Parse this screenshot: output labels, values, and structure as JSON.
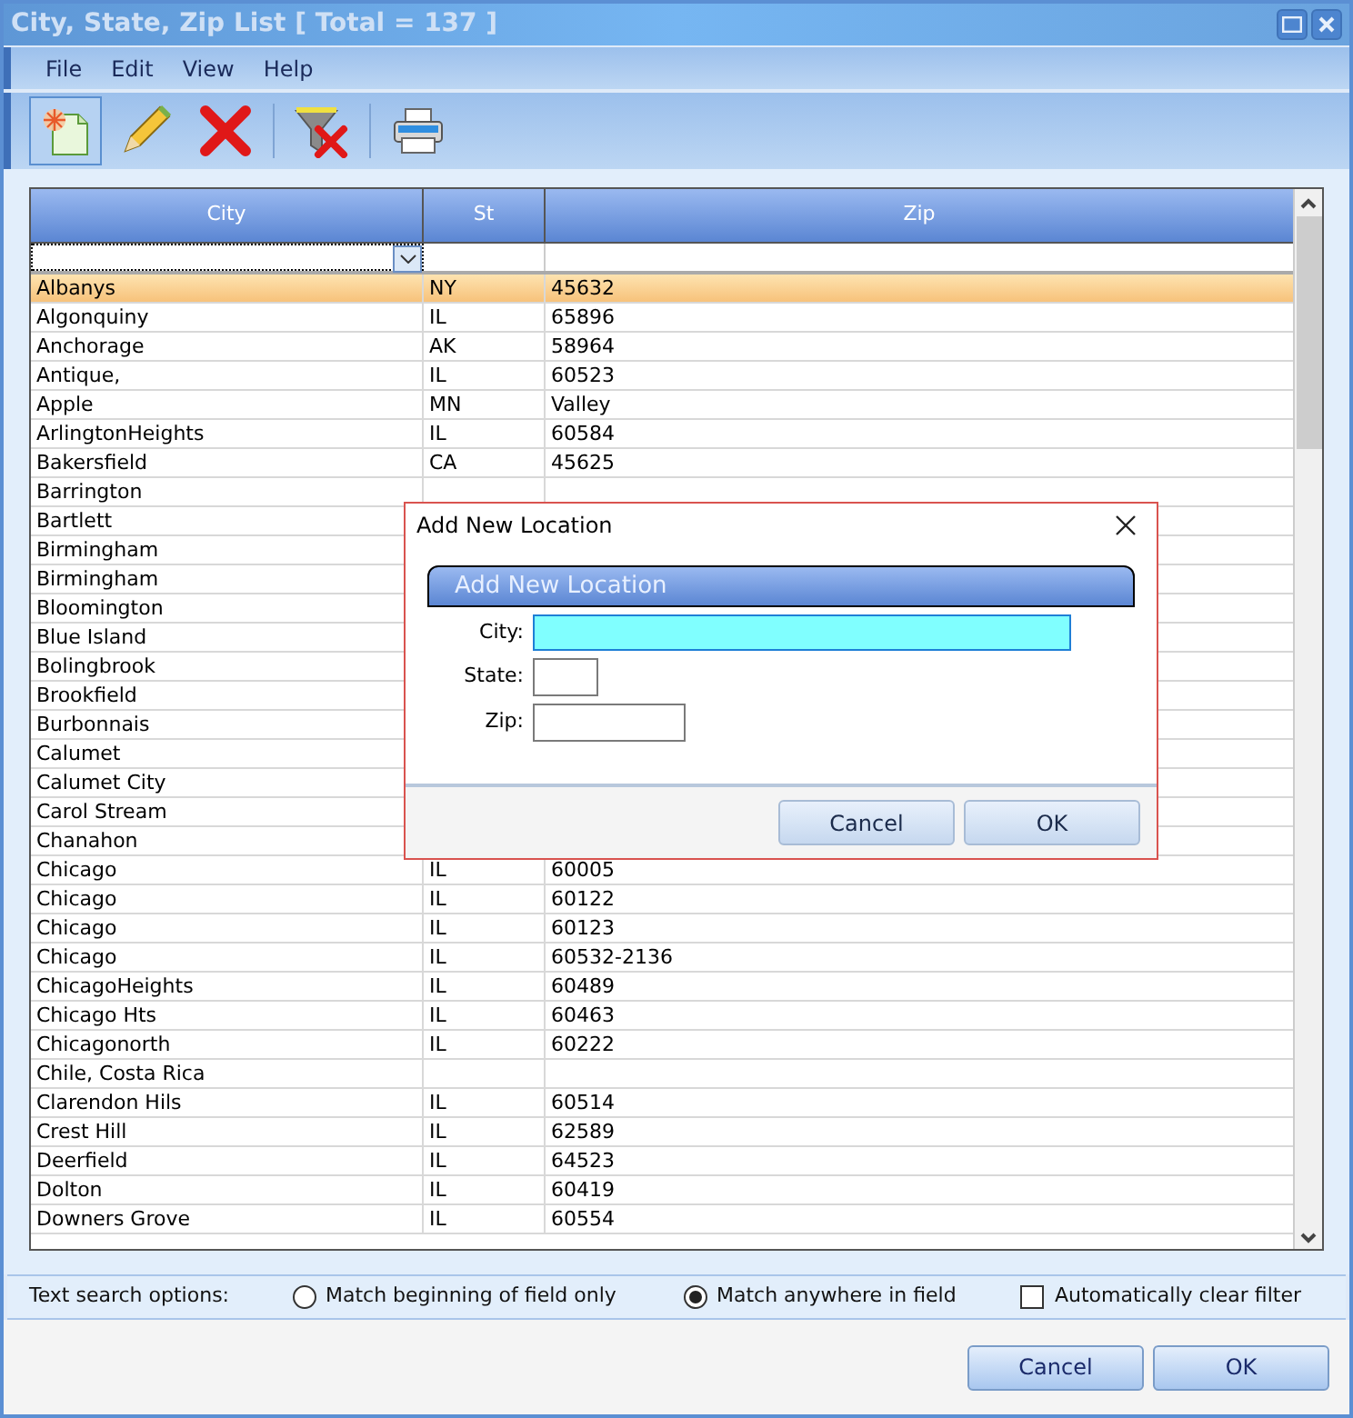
{
  "window": {
    "title": "City, State, Zip List [ Total = 137 ]"
  },
  "menu": [
    "File",
    "Edit",
    "View",
    "Help"
  ],
  "toolbar": [
    {
      "kind": "new",
      "selected": true
    },
    {
      "kind": "edit",
      "selected": false
    },
    {
      "kind": "delete",
      "selected": false
    },
    {
      "kind": "sep"
    },
    {
      "kind": "clearfilter",
      "selected": false
    },
    {
      "kind": "sep"
    },
    {
      "kind": "print",
      "selected": false
    }
  ],
  "table": {
    "columns": [
      "City",
      "St",
      "Zip"
    ],
    "rows": [
      {
        "city": "Albanys",
        "st": "NY",
        "zip": "45632",
        "selected": true
      },
      {
        "city": "Algonquiny",
        "st": "IL",
        "zip": "65896",
        "selected": false
      },
      {
        "city": "Anchorage",
        "st": "AK",
        "zip": "58964",
        "selected": false
      },
      {
        "city": "Antique,",
        "st": "IL",
        "zip": "60523",
        "selected": false
      },
      {
        "city": "Apple",
        "st": "MN",
        "zip": "Valley",
        "selected": false
      },
      {
        "city": "ArlingtonHeights",
        "st": "IL",
        "zip": "60584",
        "selected": false
      },
      {
        "city": "Bakersfield",
        "st": "CA",
        "zip": "45625",
        "selected": false
      },
      {
        "city": "Barrington",
        "selected": false
      },
      {
        "city": "Bartlett",
        "selected": false
      },
      {
        "city": "Birmingham",
        "selected": false
      },
      {
        "city": "Birmingham",
        "selected": false
      },
      {
        "city": "Bloomington",
        "selected": false
      },
      {
        "city": "Blue Island",
        "selected": false
      },
      {
        "city": "Bolingbrook",
        "selected": false
      },
      {
        "city": "Brookfield",
        "selected": false
      },
      {
        "city": "Burbonnais",
        "selected": false
      },
      {
        "city": "Calumet",
        "selected": false
      },
      {
        "city": "Calumet City",
        "selected": false
      },
      {
        "city": "Carol Stream",
        "selected": false
      },
      {
        "city": "Chanahon",
        "selected": false
      },
      {
        "city": "Chicago",
        "st": "IL",
        "zip": "60005",
        "selected": false
      },
      {
        "city": "Chicago",
        "st": "IL",
        "zip": "60122",
        "selected": false
      },
      {
        "city": "Chicago",
        "st": "IL",
        "zip": "60123",
        "selected": false
      },
      {
        "city": "Chicago",
        "st": "IL",
        "zip": "60532-2136",
        "selected": false
      },
      {
        "city": "ChicagoHeights",
        "st": "IL",
        "zip": "60489",
        "selected": false
      },
      {
        "city": "Chicago Hts",
        "st": "IL",
        "zip": "60463",
        "selected": false
      },
      {
        "city": "Chicagonorth",
        "st": "IL",
        "zip": "60222",
        "selected": false
      },
      {
        "city": "Chile, Costa Rica",
        "selected": false
      },
      {
        "city": "Clarendon Hils",
        "st": "IL",
        "zip": "60514",
        "selected": false
      },
      {
        "city": "Crest Hill",
        "st": "IL",
        "zip": "62589",
        "selected": false
      },
      {
        "city": "Deerfield",
        "st": "IL",
        "zip": "64523",
        "selected": false
      },
      {
        "city": "Dolton",
        "st": "IL",
        "zip": "60419",
        "selected": false
      },
      {
        "city": "Downers Grove",
        "st": "IL",
        "zip": "60554",
        "selected": false
      }
    ]
  },
  "search_options": {
    "label": "Text search options:",
    "radios": [
      {
        "label": "Match beginning of field only",
        "selected": false
      },
      {
        "label": "Match anywhere in field",
        "selected": true
      }
    ],
    "checkbox": {
      "label": "Automatically clear filter",
      "checked": false
    }
  },
  "buttons": [
    "Cancel",
    "OK"
  ],
  "dialog": {
    "title": "Add New Location",
    "header": "Add New Location",
    "fields": [
      {
        "label": "City:",
        "focused": true
      },
      {
        "label": "State:",
        "focused": false
      },
      {
        "label": "Zip:",
        "focused": false
      }
    ],
    "buttons": [
      "Cancel",
      "OK"
    ]
  }
}
